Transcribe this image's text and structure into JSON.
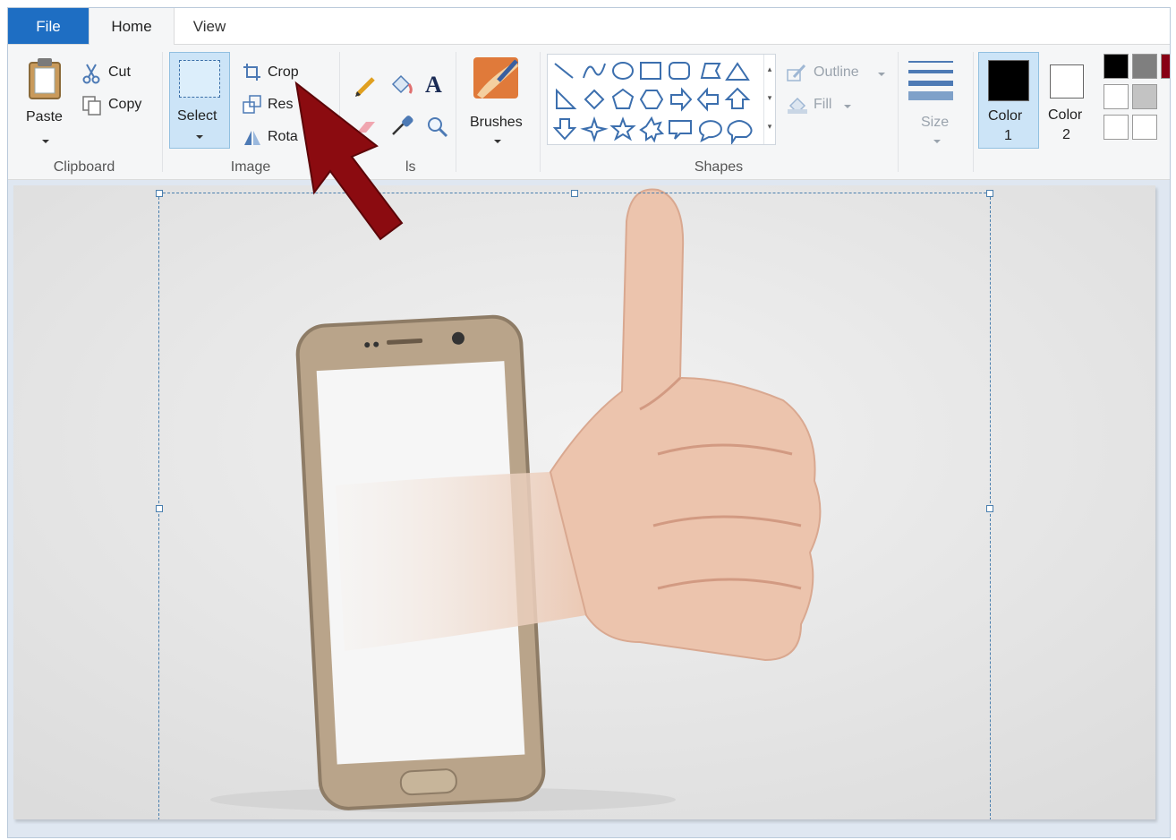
{
  "menu": {
    "file": "File",
    "home": "Home",
    "view": "View"
  },
  "clipboard": {
    "paste": "Paste",
    "cut": "Cut",
    "copy": "Copy",
    "group": "Clipboard"
  },
  "image": {
    "select": "Select",
    "crop": "Crop",
    "resize": "Res",
    "rotate": "Rota",
    "group": "Image"
  },
  "tools": {
    "group_partial": "ls"
  },
  "brushes": {
    "label": "Brushes"
  },
  "shapes": {
    "outline": "Outline",
    "fill": "Fill",
    "group": "Shapes"
  },
  "size": {
    "label": "Size"
  },
  "colors": {
    "color1_line1": "Color",
    "color1_line2": "1",
    "color2_line1": "Color",
    "color2_line2": "2",
    "color1_value": "#000000",
    "color2_value": "#ffffff"
  },
  "icons": [
    "clipboard-icon",
    "scissors-icon",
    "copy-icon",
    "crop-icon",
    "resize-icon",
    "rotate-icon",
    "pencil-icon",
    "fill-bucket-icon",
    "text-icon",
    "eraser-icon",
    "color-picker-icon",
    "magnifier-icon",
    "brush-icon",
    "size-lines-icon",
    "arrow-pointer-overlay"
  ]
}
